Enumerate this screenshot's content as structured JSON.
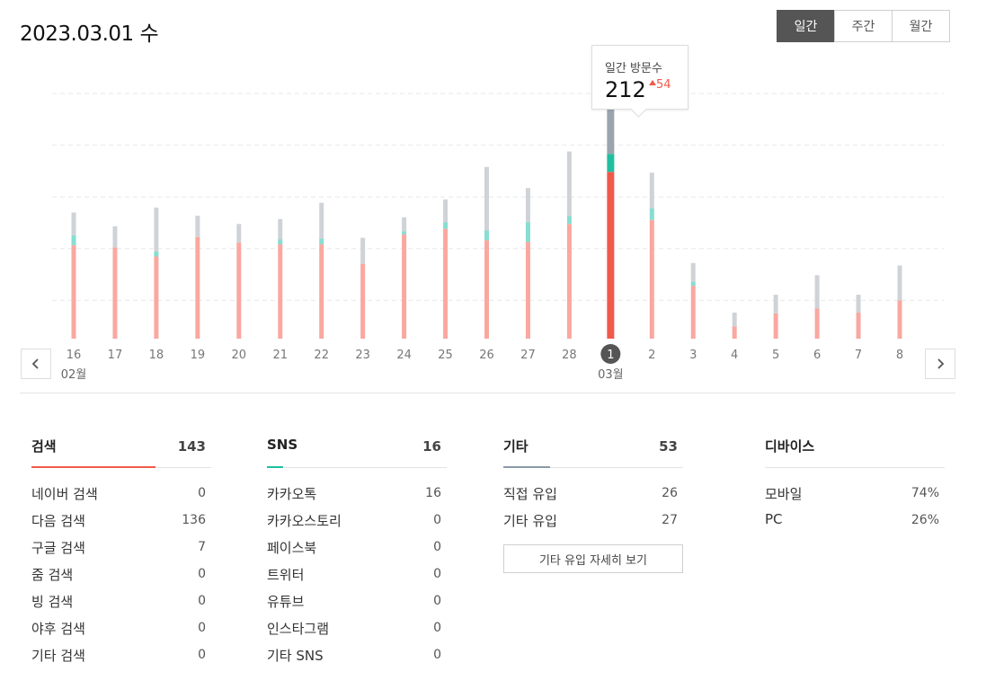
{
  "header": {
    "date": "2023.03.01 수",
    "period_tabs": [
      {
        "label": "일간",
        "active": true
      },
      {
        "label": "주간",
        "active": false
      },
      {
        "label": "월간",
        "active": false
      }
    ]
  },
  "chart_data": {
    "type": "bar",
    "stacked": true,
    "categories": [
      "16",
      "17",
      "18",
      "19",
      "20",
      "21",
      "22",
      "23",
      "24",
      "25",
      "26",
      "27",
      "28",
      "1",
      "2",
      "3",
      "4",
      "5",
      "6",
      "7",
      "8"
    ],
    "month_labels": [
      {
        "index": 0,
        "label": "02월"
      },
      {
        "index": 13,
        "label": "03월"
      }
    ],
    "selected_index": 13,
    "series": [
      {
        "color": "#f9a8a0",
        "highlight_color": "#f05a4a",
        "values": [
          115,
          112,
          101,
          125,
          118,
          116,
          116,
          92,
          128,
          135,
          121,
          119,
          141,
          205,
          146,
          65,
          15,
          31,
          37,
          32,
          47
        ]
      },
      {
        "color": "#86ddd1",
        "highlight_color": "#1fbf9f",
        "values": [
          12,
          0,
          6,
          0,
          0,
          6,
          7,
          0,
          4,
          8,
          12,
          24,
          10,
          22,
          14,
          5,
          0,
          0,
          0,
          0,
          0
        ]
      },
      {
        "color": "#cfd3d8",
        "highlight_color": "#9aa4ae",
        "values": [
          28,
          26,
          54,
          26,
          23,
          25,
          44,
          32,
          17,
          28,
          78,
          42,
          79,
          79,
          44,
          23,
          17,
          23,
          41,
          22,
          43
        ]
      }
    ],
    "grid": true,
    "grid_lines": 5,
    "ylim": [
      0,
      372
    ],
    "colors": {
      "accent_red": "#f05a4a",
      "accent_teal": "#1fbf9f",
      "accent_gray": "#9aa4ae"
    }
  },
  "tooltip": {
    "label": "일간 방문수",
    "value": "212",
    "delta": "54",
    "delta_icon": "up-triangle-icon"
  },
  "nav": {
    "prev_icon": "chevron-left-icon",
    "next_icon": "chevron-right-icon"
  },
  "stats": {
    "search": {
      "title": "검색",
      "total": "143",
      "underline_color": "#f05a4a",
      "underline_ratio": 0.69,
      "rows": [
        {
          "label": "네이버 검색",
          "value": "0"
        },
        {
          "label": "다음 검색",
          "value": "136"
        },
        {
          "label": "구글 검색",
          "value": "7"
        },
        {
          "label": "줌 검색",
          "value": "0"
        },
        {
          "label": "빙 검색",
          "value": "0"
        },
        {
          "label": "야후 검색",
          "value": "0"
        },
        {
          "label": "기타 검색",
          "value": "0"
        }
      ]
    },
    "sns": {
      "title": "SNS",
      "total": "16",
      "underline_color": "#1fbf9f",
      "underline_ratio": 0.09,
      "rows": [
        {
          "label": "카카오톡",
          "value": "16"
        },
        {
          "label": "카카오스토리",
          "value": "0"
        },
        {
          "label": "페이스북",
          "value": "0"
        },
        {
          "label": "트위터",
          "value": "0"
        },
        {
          "label": "유튜브",
          "value": "0"
        },
        {
          "label": "인스타그램",
          "value": "0"
        },
        {
          "label": "기타 SNS",
          "value": "0"
        }
      ]
    },
    "other": {
      "title": "기타",
      "total": "53",
      "underline_color": "#8b99a8",
      "underline_ratio": 0.26,
      "rows": [
        {
          "label": "직접 유입",
          "value": "26"
        },
        {
          "label": "기타 유입",
          "value": "27"
        }
      ],
      "more_button": "기타 유입 자세히 보기"
    },
    "device": {
      "title": "디바이스",
      "rows": [
        {
          "label": "모바일",
          "value": "74%"
        },
        {
          "label": "PC",
          "value": "26%"
        }
      ]
    }
  }
}
